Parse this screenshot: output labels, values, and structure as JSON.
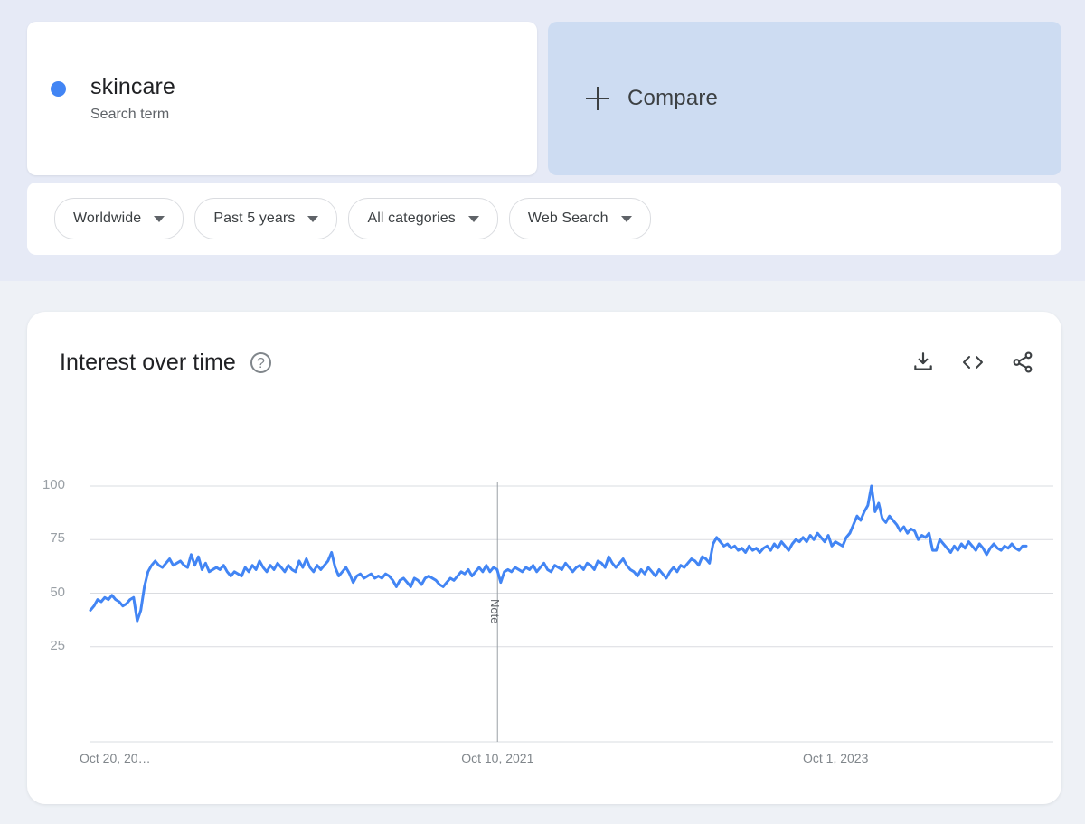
{
  "theme": {
    "accent": "#4285f4",
    "page_bg": "#eef1f6",
    "banner_bg": "#e6eaf6",
    "card_bg": "#ffffff",
    "compare_bg": "#cddcf2",
    "text_primary": "#202124",
    "text_secondary": "#5f6368",
    "axis_text": "#9aa0a6",
    "grid": "#dadce0"
  },
  "query": {
    "term": {
      "name": "skincare",
      "kind": "Search term",
      "dot_color": "#4285f4"
    },
    "compare": {
      "label": "Compare",
      "icon": "plus-icon"
    }
  },
  "filters": [
    {
      "name": "location",
      "label": "Worldwide",
      "icon": "chevron-down-icon"
    },
    {
      "name": "time-range",
      "label": "Past 5 years",
      "icon": "chevron-down-icon"
    },
    {
      "name": "category",
      "label": "All categories",
      "icon": "chevron-down-icon"
    },
    {
      "name": "search-type",
      "label": "Web Search",
      "icon": "chevron-down-icon"
    }
  ],
  "chart_card": {
    "title": "Interest over time",
    "help_icon": "help-icon",
    "help_glyph": "?",
    "actions": [
      {
        "name": "download-button",
        "icon": "download-icon"
      },
      {
        "name": "embed-button",
        "icon": "embed-code-icon"
      },
      {
        "name": "share-button",
        "icon": "share-icon"
      }
    ]
  },
  "chart_data": {
    "type": "line",
    "title": "Interest over time",
    "xlabel": "",
    "ylabel": "",
    "ylim": [
      0,
      100
    ],
    "yticks": [
      25,
      50,
      75,
      100
    ],
    "grid": true,
    "legend": false,
    "line_color": "#4285f4",
    "line_width": 3,
    "xtick_labels": [
      "Oct 20, 20…",
      "Oct 10, 2021",
      "Oct 1, 2023"
    ],
    "xtick_positions": [
      0,
      0.435,
      0.8
    ],
    "annotations": [
      {
        "label": "Note",
        "x_fraction": 0.435,
        "rotated": true
      }
    ],
    "series": [
      {
        "name": "skincare",
        "color": "#4285f4",
        "values": [
          42,
          44,
          47,
          46,
          48,
          47,
          49,
          47,
          46,
          44,
          45,
          47,
          48,
          37,
          42,
          53,
          60,
          63,
          65,
          63,
          62,
          64,
          66,
          63,
          64,
          65,
          63,
          62,
          68,
          63,
          67,
          61,
          64,
          60,
          61,
          62,
          61,
          63,
          60,
          58,
          60,
          59,
          58,
          62,
          60,
          63,
          61,
          65,
          62,
          60,
          63,
          61,
          64,
          62,
          60,
          63,
          61,
          60,
          65,
          62,
          66,
          62,
          60,
          63,
          61,
          63,
          65,
          69,
          62,
          58,
          60,
          62,
          59,
          55,
          58,
          59,
          57,
          58,
          59,
          57,
          58,
          57,
          59,
          58,
          56,
          53,
          56,
          57,
          55,
          53,
          57,
          56,
          54,
          57,
          58,
          57,
          56,
          54,
          53,
          55,
          57,
          56,
          58,
          60,
          59,
          61,
          58,
          60,
          62,
          60,
          63,
          60,
          62,
          61,
          55,
          60,
          61,
          60,
          62,
          61,
          60,
          62,
          61,
          63,
          60,
          62,
          64,
          61,
          60,
          63,
          62,
          61,
          64,
          62,
          60,
          62,
          63,
          61,
          64,
          63,
          61,
          65,
          64,
          62,
          67,
          64,
          62,
          64,
          66,
          63,
          61,
          60,
          58,
          61,
          59,
          62,
          60,
          58,
          61,
          59,
          57,
          60,
          62,
          60,
          63,
          62,
          64,
          66,
          65,
          63,
          67,
          66,
          64,
          73,
          76,
          74,
          72,
          73,
          71,
          72,
          70,
          71,
          69,
          72,
          70,
          71,
          69,
          71,
          72,
          70,
          73,
          71,
          74,
          72,
          70,
          73,
          75,
          74,
          76,
          74,
          77,
          75,
          78,
          76,
          74,
          77,
          72,
          74,
          73,
          72,
          76,
          78,
          82,
          86,
          84,
          88,
          91,
          100,
          88,
          92,
          85,
          83,
          86,
          84,
          82,
          79,
          81,
          78,
          80,
          79,
          75,
          77,
          76,
          78,
          70,
          70,
          75,
          73,
          71,
          69,
          72,
          70,
          73,
          71,
          74,
          72,
          70,
          73,
          71,
          68,
          71,
          73,
          71,
          70,
          72,
          71,
          73,
          71,
          70,
          72,
          72
        ]
      }
    ]
  }
}
